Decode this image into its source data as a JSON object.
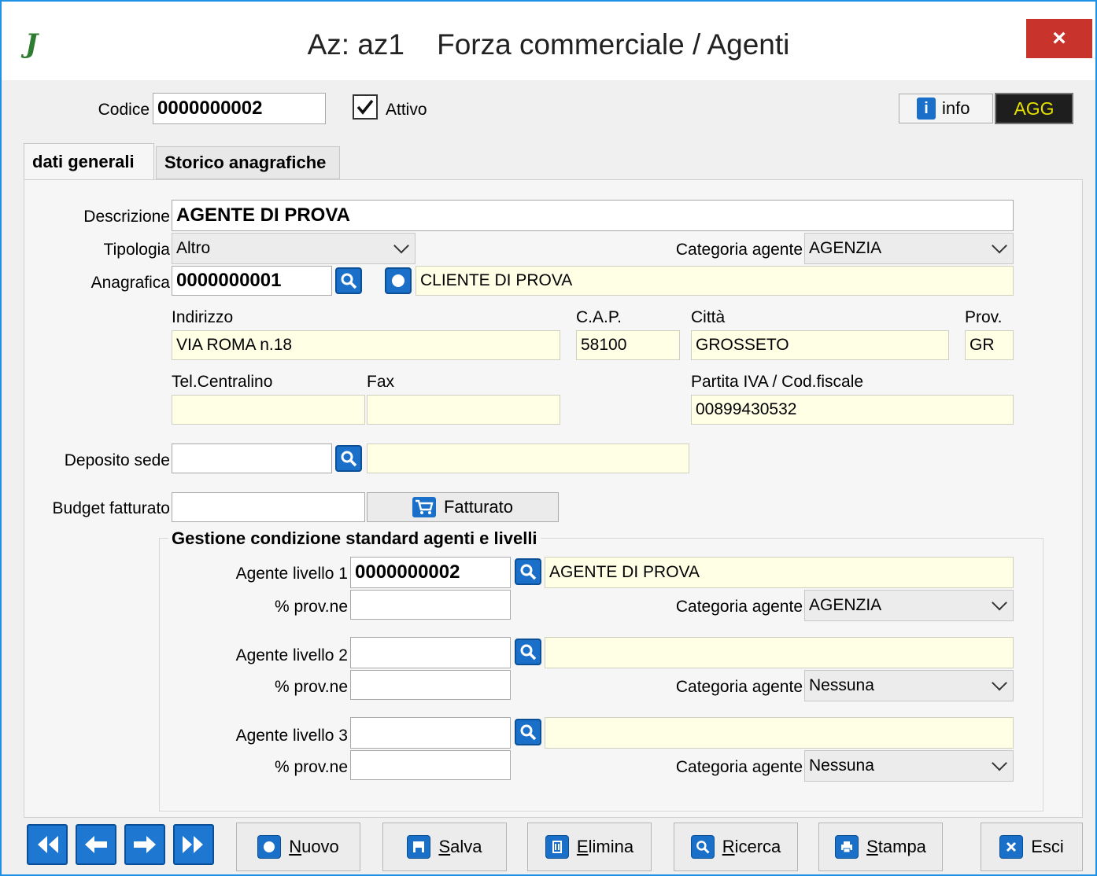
{
  "window": {
    "title": "Az: az1    Forza commerciale / Agenti",
    "close_label": "×",
    "logo": "J"
  },
  "header": {
    "codice_label": "Codice",
    "codice_value": "0000000002",
    "attivo_label": "Attivo",
    "attivo_checked": true,
    "info_label": "info",
    "agg_label": "AGG"
  },
  "tabs": [
    {
      "label": "dati generali",
      "active": true
    },
    {
      "label": "Storico anagrafiche",
      "active": false
    }
  ],
  "form": {
    "descrizione_label": "Descrizione",
    "descrizione_value": "AGENTE DI PROVA",
    "tipologia_label": "Tipologia",
    "tipologia_value": "Altro",
    "categoria_label": "Categoria agente",
    "categoria_value": "AGENZIA",
    "anagrafica_label": "Anagrafica",
    "anagrafica_value": "0000000001",
    "anagrafica_desc": "CLIENTE DI PROVA",
    "indirizzo_label": "Indirizzo",
    "indirizzo_value": "VIA ROMA n.18",
    "cap_label": "C.A.P.",
    "cap_value": "58100",
    "citta_label": "Città",
    "citta_value": "GROSSETO",
    "prov_label": "Prov.",
    "prov_value": "GR",
    "tel_label": "Tel.Centralino",
    "tel_value": "",
    "fax_label": "Fax",
    "fax_value": "",
    "piva_label": "Partita IVA / Cod.fiscale",
    "piva_value": "00899430532",
    "deposito_label": "Deposito sede",
    "deposito_value": "",
    "deposito_desc": "",
    "budget_label": "Budget fatturato",
    "budget_value": "",
    "fatturato_label": "Fatturato"
  },
  "group": {
    "title": "Gestione condizione standard agenti e livelli",
    "levels": [
      {
        "agente_label": "Agente livello 1",
        "code": "0000000002",
        "desc": "AGENTE DI PROVA",
        "prov_label": "% prov.ne",
        "prov_value": "",
        "cat_label": "Categoria agente",
        "cat_value": "AGENZIA"
      },
      {
        "agente_label": "Agente livello 2",
        "code": "",
        "desc": "",
        "prov_label": "% prov.ne",
        "prov_value": "",
        "cat_label": "Categoria agente",
        "cat_value": "Nessuna"
      },
      {
        "agente_label": "Agente livello 3",
        "code": "",
        "desc": "",
        "prov_label": "% prov.ne",
        "prov_value": "",
        "cat_label": "Categoria agente",
        "cat_value": "Nessuna"
      }
    ]
  },
  "toolbar": {
    "nuovo_accel": "N",
    "nuovo_rest": "uovo",
    "salva_accel": "S",
    "salva_rest": "alva",
    "elimina_accel": "E",
    "elimina_rest": "limina",
    "ricerca_accel": "R",
    "ricerca_rest": "icerca",
    "stampa_accel": "S",
    "stampa_rest": "tampa",
    "esci_label": "Esci"
  },
  "colors": {
    "window_border": "#1e90e6",
    "close": "#c8332b",
    "icon_blue": "#1a6fc9",
    "readonly_bg": "#ffffe6",
    "agg_text": "#e5e000"
  }
}
